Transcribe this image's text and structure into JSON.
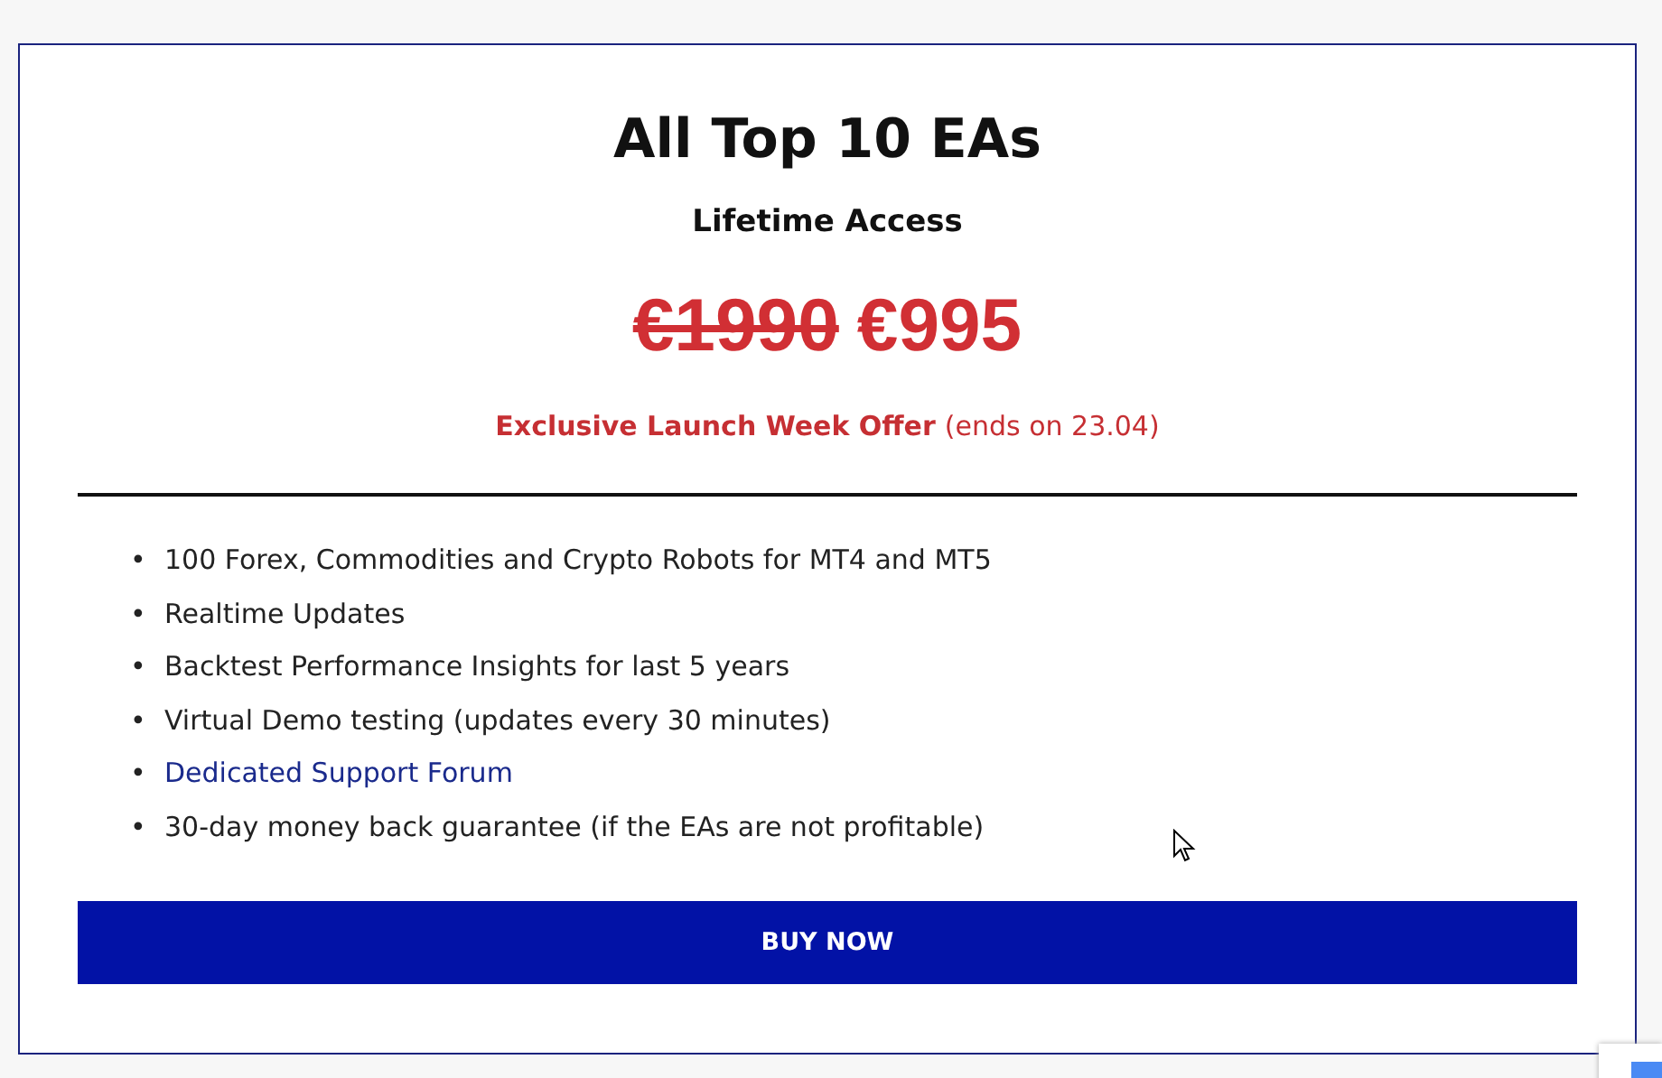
{
  "title": "All Top 10 EAs",
  "subtitle": "Lifetime Access",
  "price": {
    "old": "€1990",
    "new": "€995"
  },
  "offer": {
    "highlight": "Exclusive Launch Week Offer",
    "note": "(ends on 23.04)"
  },
  "features": [
    {
      "kind": "text",
      "bullet": "•",
      "label": "100 Forex, Commodities and Crypto Robots for MT4 and MT5"
    },
    {
      "kind": "text",
      "bullet": "•",
      "label": "Realtime Updates"
    },
    {
      "kind": "text",
      "bullet": "•",
      "label": "Backtest Performance Insights for last 5 years"
    },
    {
      "kind": "text",
      "bullet": "•",
      "label": "Virtual Demo testing (updates every 30 minutes)"
    },
    {
      "kind": "link",
      "bullet": "•",
      "label": "Dedicated Support Forum"
    },
    {
      "kind": "text",
      "bullet": "•",
      "label": "30-day money back guarantee (if the EAs are not profitable)"
    }
  ],
  "button": "BUY NOW"
}
